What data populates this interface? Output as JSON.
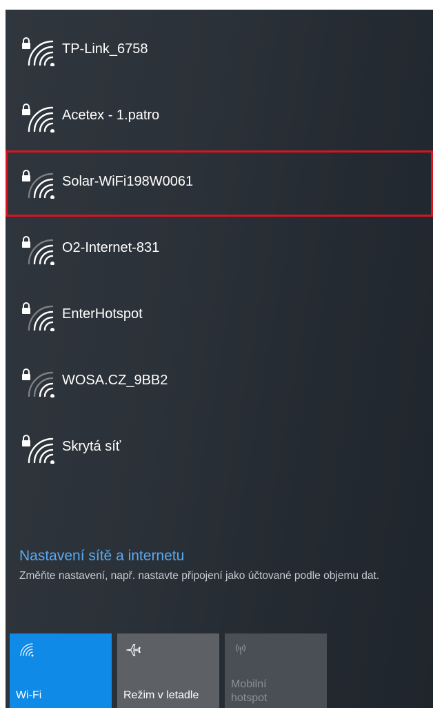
{
  "networks": [
    {
      "name": "TP-Link_6758",
      "secured": true,
      "signal_bars": 3
    },
    {
      "name": "Acetex - 1.patro",
      "secured": true,
      "signal_bars": 3
    },
    {
      "name": "Solar-WiFi198W0061",
      "secured": true,
      "signal_bars": 2,
      "highlighted": true
    },
    {
      "name": "O2-Internet-831",
      "secured": true,
      "signal_bars": 2
    },
    {
      "name": "EnterHotspot",
      "secured": true,
      "signal_bars": 2
    },
    {
      "name": "WOSA.CZ_9BB2",
      "secured": true,
      "signal_bars": 1
    },
    {
      "name": "Skrytá síť",
      "secured": true,
      "signal_bars": 3
    }
  ],
  "settings": {
    "link": "Nastavení sítě a internetu",
    "description": "Změňte nastavení, např. nastavte připojení jako účtované podle objemu dat."
  },
  "quick_actions": {
    "wifi": {
      "label": "Wi-Fi",
      "active": true,
      "icon": "wifi-icon"
    },
    "airplane": {
      "label": "Režim v letadle",
      "active": false,
      "icon": "airplane-icon"
    },
    "hotspot": {
      "line1": "Mobilní",
      "line2": "hotspot",
      "active": false,
      "disabled": true,
      "icon": "hotspot-icon"
    }
  },
  "colors": {
    "accent": "#0f8ae6",
    "highlight_border": "#e0101e",
    "link": "#5aa9f0"
  }
}
